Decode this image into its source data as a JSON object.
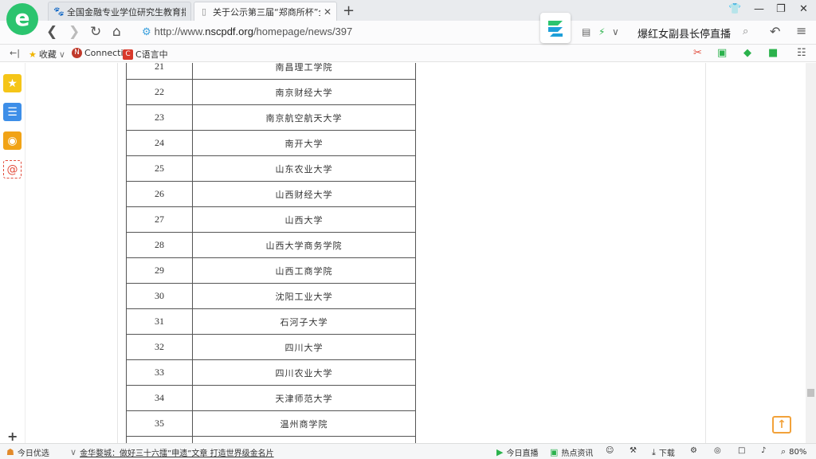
{
  "browser": {
    "logo_letter": "e",
    "tabs": [
      {
        "title": "全国金融专业学位研究生教育指导",
        "icon": "paw-icon",
        "active": false
      },
      {
        "title": "关于公示第三届“郑商所杯”全国大",
        "icon": "page-icon",
        "active": true
      }
    ],
    "url_prefix": "http://www.",
    "url_domain": "nscpdf.org",
    "url_path": "/homepage/news/397",
    "search_text": "爆红女副县长停直播"
  },
  "bookmarks": [
    {
      "label": "收藏",
      "icon": "star-icon"
    },
    {
      "label": "Connecti",
      "icon": "connect-icon"
    },
    {
      "label": "C语言中",
      "icon": "c-icon"
    }
  ],
  "table": {
    "rows": [
      {
        "num": "21",
        "name": "南昌理工学院"
      },
      {
        "num": "22",
        "name": "南京财经大学"
      },
      {
        "num": "23",
        "name": "南京航空航天大学"
      },
      {
        "num": "24",
        "name": "南开大学"
      },
      {
        "num": "25",
        "name": "山东农业大学"
      },
      {
        "num": "26",
        "name": "山西财经大学"
      },
      {
        "num": "27",
        "name": "山西大学"
      },
      {
        "num": "28",
        "name": "山西大学商务学院"
      },
      {
        "num": "29",
        "name": "山西工商学院"
      },
      {
        "num": "30",
        "name": "沈阳工业大学"
      },
      {
        "num": "31",
        "name": "石河子大学"
      },
      {
        "num": "32",
        "name": "四川大学"
      },
      {
        "num": "33",
        "name": "四川农业大学"
      },
      {
        "num": "34",
        "name": "天津师范大学"
      },
      {
        "num": "35",
        "name": "温州商学院"
      },
      {
        "num": "",
        "name": ""
      }
    ]
  },
  "statusbar": {
    "today_pick": "今日优选",
    "news": "金华婺城：做好三十六擂”申遗”文章 打造世界级金名片",
    "live": "今日直播",
    "hot": "热点资讯",
    "download": "下载",
    "zoom": "80%"
  }
}
